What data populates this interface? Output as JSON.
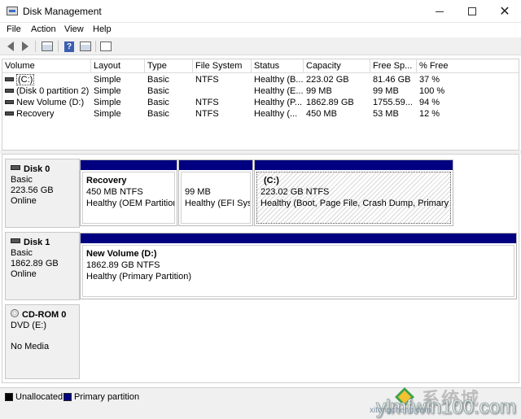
{
  "window": {
    "title": "Disk Management"
  },
  "menu": [
    "File",
    "Action",
    "View",
    "Help"
  ],
  "columns": [
    "Volume",
    "Layout",
    "Type",
    "File System",
    "Status",
    "Capacity",
    "Free Sp...",
    "% Free"
  ],
  "volumes": [
    {
      "volume": "(C:)",
      "layout": "Simple",
      "type": "Basic",
      "fs": "NTFS",
      "status": "Healthy (B...",
      "capacity": "223.02 GB",
      "free": "81.46 GB",
      "pct": "37 %"
    },
    {
      "volume": "(Disk 0 partition 2)",
      "layout": "Simple",
      "type": "Basic",
      "fs": "",
      "status": "Healthy (E...",
      "capacity": "99 MB",
      "free": "99 MB",
      "pct": "100 %"
    },
    {
      "volume": "New Volume (D:)",
      "layout": "Simple",
      "type": "Basic",
      "fs": "NTFS",
      "status": "Healthy (P...",
      "capacity": "1862.89 GB",
      "free": "1755.59...",
      "pct": "94 %"
    },
    {
      "volume": "Recovery",
      "layout": "Simple",
      "type": "Basic",
      "fs": "NTFS",
      "status": "Healthy (...",
      "capacity": "450 MB",
      "free": "53 MB",
      "pct": "12 %"
    }
  ],
  "disks": [
    {
      "name": "Disk 0",
      "kind": "Basic",
      "size": "223.56 GB",
      "state": "Online",
      "partitions": [
        {
          "name": "Recovery",
          "size": "450 MB NTFS",
          "status": "Healthy (OEM Partition)"
        },
        {
          "name": "",
          "size": "99 MB",
          "status": "Healthy (EFI System Partition)"
        },
        {
          "name": "(C:)",
          "size": "223.02 GB NTFS",
          "status": "Healthy (Boot, Page File, Crash Dump, Primary Partition)"
        }
      ]
    },
    {
      "name": "Disk 1",
      "kind": "Basic",
      "size": "1862.89 GB",
      "state": "Online",
      "partitions": [
        {
          "name": "New Volume  (D:)",
          "size": "1862.89 GB NTFS",
          "status": "Healthy (Primary Partition)"
        }
      ]
    },
    {
      "name": "CD-ROM 0",
      "kind": "DVD (E:)",
      "size": "",
      "state": "No Media"
    }
  ],
  "legend": {
    "unallocated": "Unallocated",
    "primary": "Primary partition"
  },
  "colors": {
    "primary": "#000080",
    "unallocated": "#000000"
  },
  "watermark": {
    "cn": "系统城",
    "main": "ylmfwin100.com",
    "sub": "xitongcheng.com"
  }
}
